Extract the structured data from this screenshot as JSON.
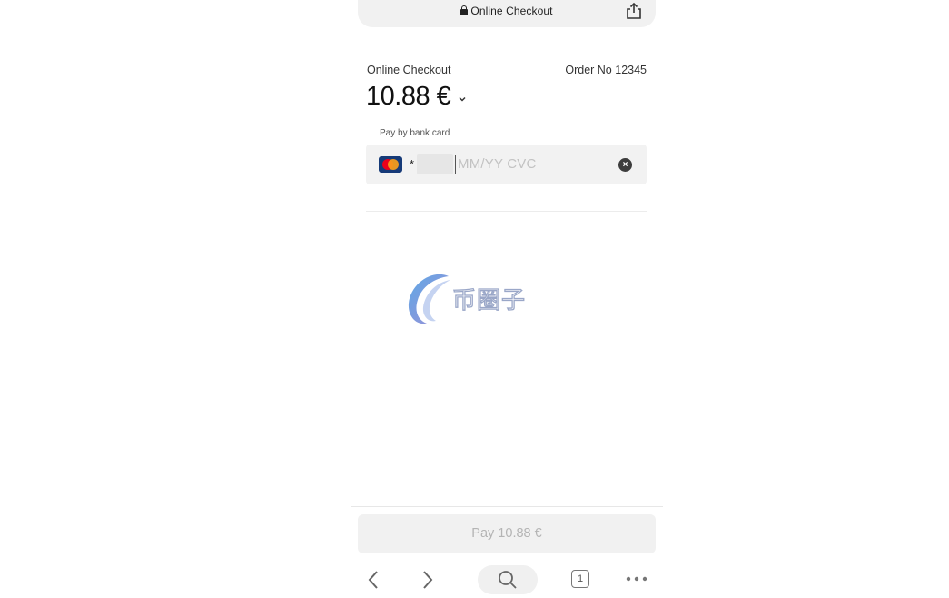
{
  "browser": {
    "url_title": "Online Checkout",
    "tab_count": "1",
    "icons": [
      "lock-icon",
      "share-icon",
      "back-icon",
      "forward-icon",
      "search-icon",
      "tabs-icon",
      "more-icon"
    ]
  },
  "checkout": {
    "title": "Online Checkout",
    "order_number": "Order No 12345",
    "amount": "10.88 €"
  },
  "payment": {
    "method_label": "Pay by bank card",
    "card_brand": "mastercard",
    "card_number_prefix": "*",
    "expiry_cvc_placeholder": "MM/YY  CVC",
    "pay_button_label": "Pay 10.88 €"
  },
  "watermark": {
    "text": "币圈子"
  },
  "colors": {
    "accent_brand_card": "#163a78",
    "mastercard_red": "#eb001b",
    "mastercard_orange": "#f79e1b",
    "disabled_button_text": "#b4b4b4",
    "field_background": "#f2f2f2"
  }
}
